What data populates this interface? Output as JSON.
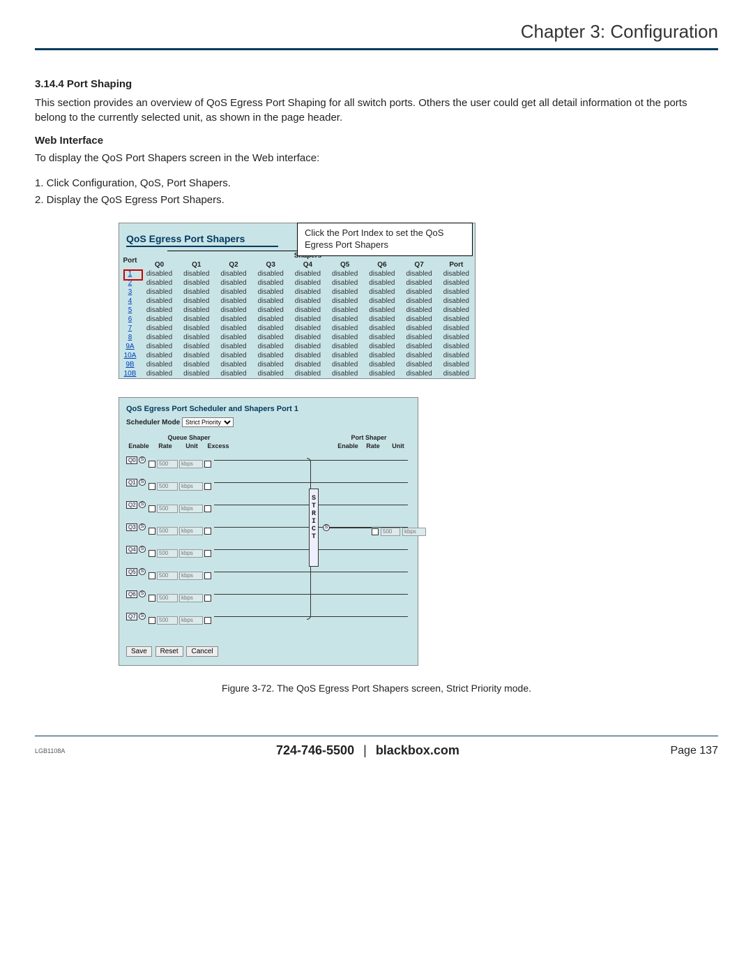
{
  "chapter_title": "Chapter 3: Configuration",
  "section": {
    "number_title": "3.14.4 Port Shaping",
    "intro": "This section provides an overview of QoS Egress Port Shaping for all switch ports. Others the user could get all detail information ot the ports belong to the currently selected unit, as shown in the page header.",
    "web_interface_heading": "Web Interface",
    "web_interface_lead": "To display the QoS Port Shapers screen in the Web interface:",
    "steps": [
      "1. Click Configuration, QoS, Port Shapers.",
      "2. Display the QoS Egress Port Shapers."
    ]
  },
  "fig1": {
    "callout": "Click the Port Index to set the QoS Egress Port Shapers",
    "panel_title": "QoS Egress Port Shapers",
    "group_header": "Shapers",
    "columns": [
      "Port",
      "Q0",
      "Q1",
      "Q2",
      "Q3",
      "Q4",
      "Q5",
      "Q6",
      "Q7",
      "Port"
    ],
    "ports": [
      "1",
      "2",
      "3",
      "4",
      "5",
      "6",
      "7",
      "8",
      "9A",
      "10A",
      "9B",
      "10B"
    ],
    "cell_value": "disabled"
  },
  "fig2": {
    "title": "QoS Egress Port Scheduler and Shapers  Port 1",
    "mode_label": "Scheduler Mode",
    "mode_value": "Strict Priority",
    "queue_shaper_header": "Queue Shaper",
    "port_shaper_header": "Port Shaper",
    "qs_sub": [
      "Enable",
      "Rate",
      "Unit",
      "Excess"
    ],
    "ps_sub": [
      "Enable",
      "Rate",
      "Unit"
    ],
    "queues": [
      "Q0",
      "Q1",
      "Q2",
      "Q3",
      "Q4",
      "Q5",
      "Q6",
      "Q7"
    ],
    "rate_placeholder": "500",
    "unit_placeholder": "kbps",
    "strict_label": "STRICT",
    "buttons": {
      "save": "Save",
      "reset": "Reset",
      "cancel": "Cancel"
    }
  },
  "figure_caption": "Figure 3-72. The QoS Egress Port Shapers screen, Strict Priority mode.",
  "footer": {
    "model": "LGB1108A",
    "phone": "724-746-5500",
    "site": "blackbox.com",
    "page_label": "Page 137"
  }
}
